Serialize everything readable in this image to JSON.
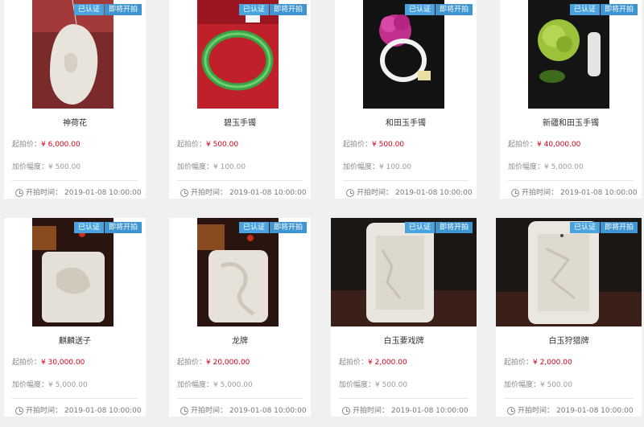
{
  "badges": {
    "verified": "已认证",
    "upcoming": "即将开拍"
  },
  "labels": {
    "start_price": "起拍价：",
    "increment": "加价幅度：",
    "start_time": "开拍时间："
  },
  "items": [
    {
      "title": "神荷花",
      "start_price": "¥ 6,000.00",
      "increment": "¥ 500.00",
      "time": "2019-01-08 10:00:00"
    },
    {
      "title": "碧玉手镯",
      "start_price": "¥ 500.00",
      "increment": "¥ 100.00",
      "time": "2019-01-08 10:00:00"
    },
    {
      "title": "和田玉手镯",
      "start_price": "¥ 500.00",
      "increment": "¥ 100.00",
      "time": "2019-01-08 10:00:00"
    },
    {
      "title": "新疆和田玉手镯",
      "start_price": "¥ 40,000.00",
      "increment": "¥ 5,000.00",
      "time": "2019-01-08 10:00:00"
    },
    {
      "title": "麒麟送子",
      "start_price": "¥ 30,000.00",
      "increment": "¥ 5,000.00",
      "time": "2019-01-08 10:00:00"
    },
    {
      "title": "龙牌",
      "start_price": "¥ 20,000.00",
      "increment": "¥ 5,000.00",
      "time": "2019-01-08 10:00:00"
    },
    {
      "title": "白玉要戏牌",
      "start_price": "¥ 2,000.00",
      "increment": "¥ 500.00",
      "time": "2019-01-08 10:00:00"
    },
    {
      "title": "白玉狩猎牌",
      "start_price": "¥ 2,000.00",
      "increment": "¥ 500.00",
      "time": "2019-01-08 10:00:00"
    }
  ]
}
